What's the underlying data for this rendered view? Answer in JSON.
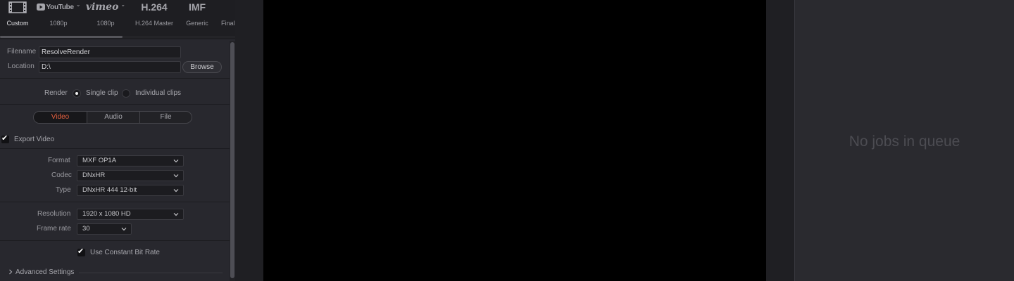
{
  "presets": [
    {
      "icon": "film-icon",
      "label": "Custom",
      "active": true
    },
    {
      "brand": "YouTube",
      "label": "1080p"
    },
    {
      "brand": "vimeo",
      "label": "1080p"
    },
    {
      "brand": "H.264",
      "label": "H.264 Master"
    },
    {
      "brand": "IMF",
      "label": "Generic"
    },
    {
      "label": "Final"
    }
  ],
  "file": {
    "filename_label": "Filename",
    "filename_value": "ResolveRender",
    "location_label": "Location",
    "location_value": "D:\\",
    "browse_label": "Browse"
  },
  "render": {
    "label": "Render",
    "single_clip": "Single clip",
    "individual_clips": "Individual clips",
    "selected": "single_clip"
  },
  "tabs": [
    {
      "label": "Video",
      "active": true
    },
    {
      "label": "Audio"
    },
    {
      "label": "File"
    }
  ],
  "video": {
    "export_video_label": "Export Video",
    "export_video_checked": true,
    "format_label": "Format",
    "format_value": "MXF OP1A",
    "codec_label": "Codec",
    "codec_value": "DNxHR",
    "type_label": "Type",
    "type_value": "DNxHR 444 12-bit",
    "resolution_label": "Resolution",
    "resolution_value": "1920 x 1080 HD",
    "framerate_label": "Frame rate",
    "framerate_value": "30",
    "cbr_label": "Use Constant Bit Rate",
    "cbr_checked": true,
    "advanced_label": "Advanced Settings"
  },
  "queue": {
    "empty_text": "No jobs in queue"
  },
  "colors": {
    "accent": "#e5603f",
    "panel_bg": "#28282e",
    "viewer_bg": "#000000"
  }
}
